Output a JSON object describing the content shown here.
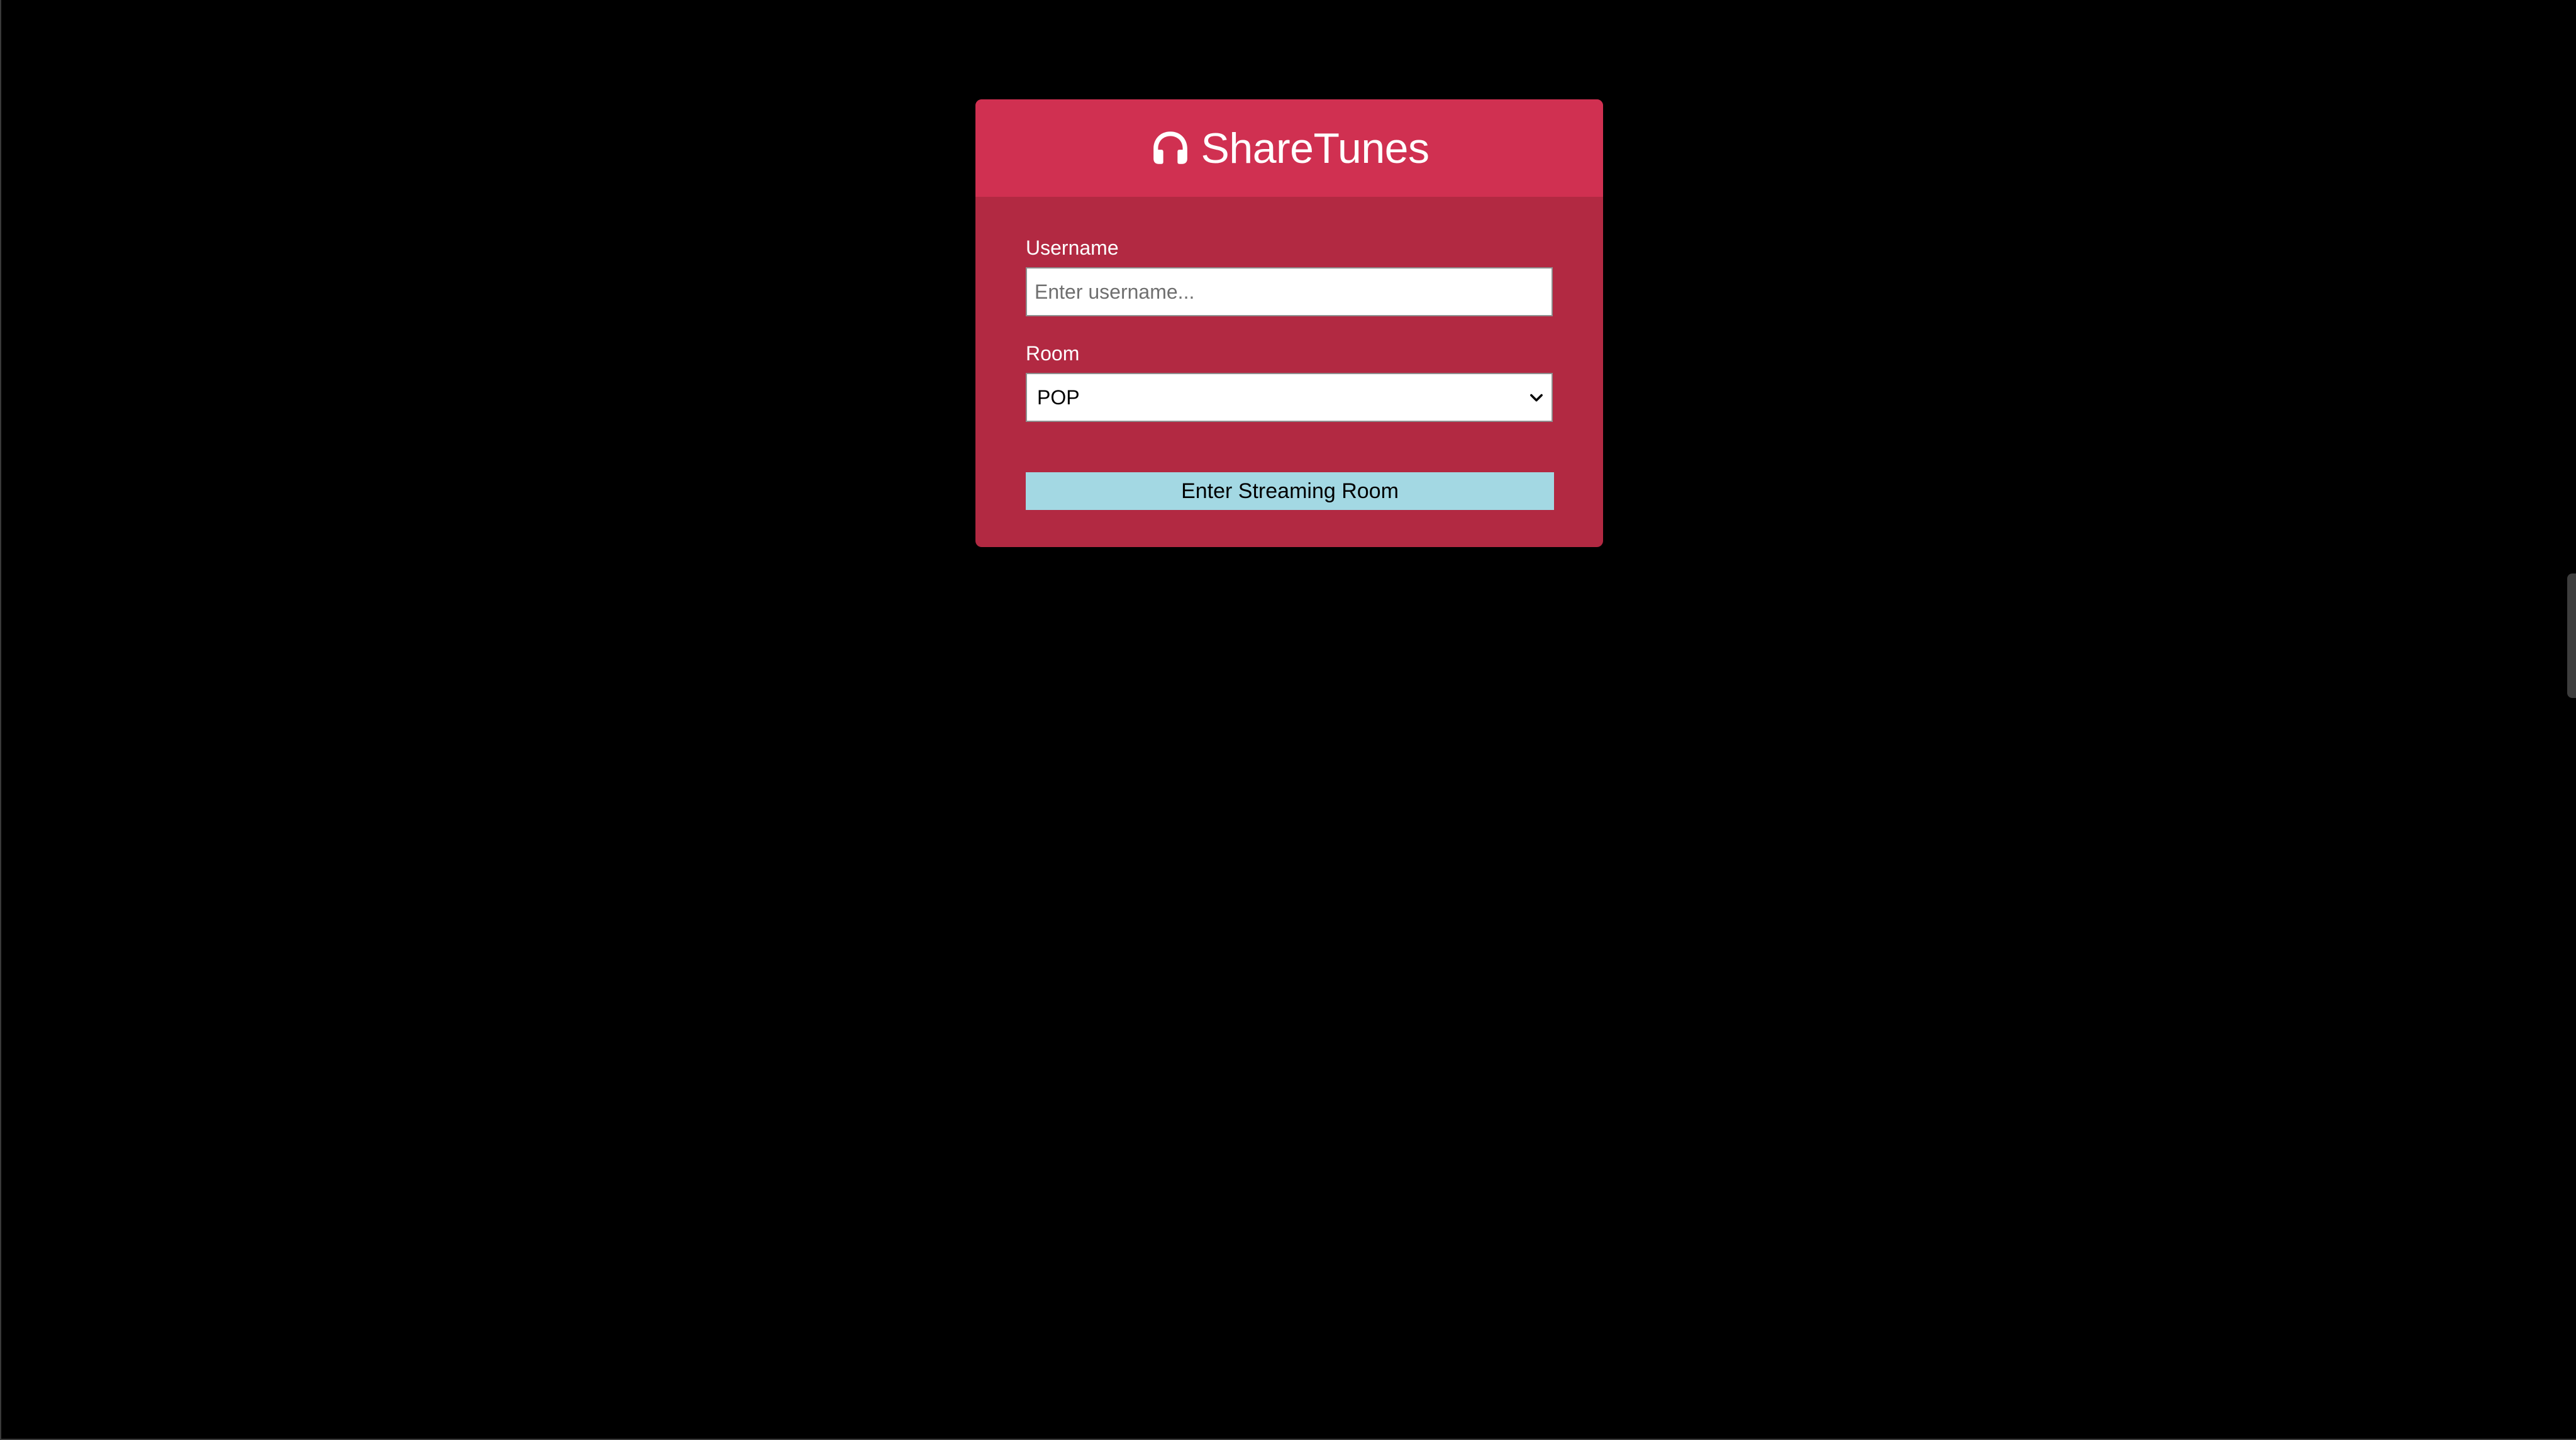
{
  "app": {
    "title": "ShareTunes",
    "icon": "headphones-icon"
  },
  "form": {
    "username_label": "Username",
    "username_placeholder": "Enter username...",
    "username_value": "",
    "room_label": "Room",
    "room_selected": "POP",
    "submit_label": "Enter Streaming Room"
  },
  "colors": {
    "background": "#000000",
    "card_header": "#d03051",
    "card_body": "#b22942",
    "button": "#a3d8e3"
  }
}
